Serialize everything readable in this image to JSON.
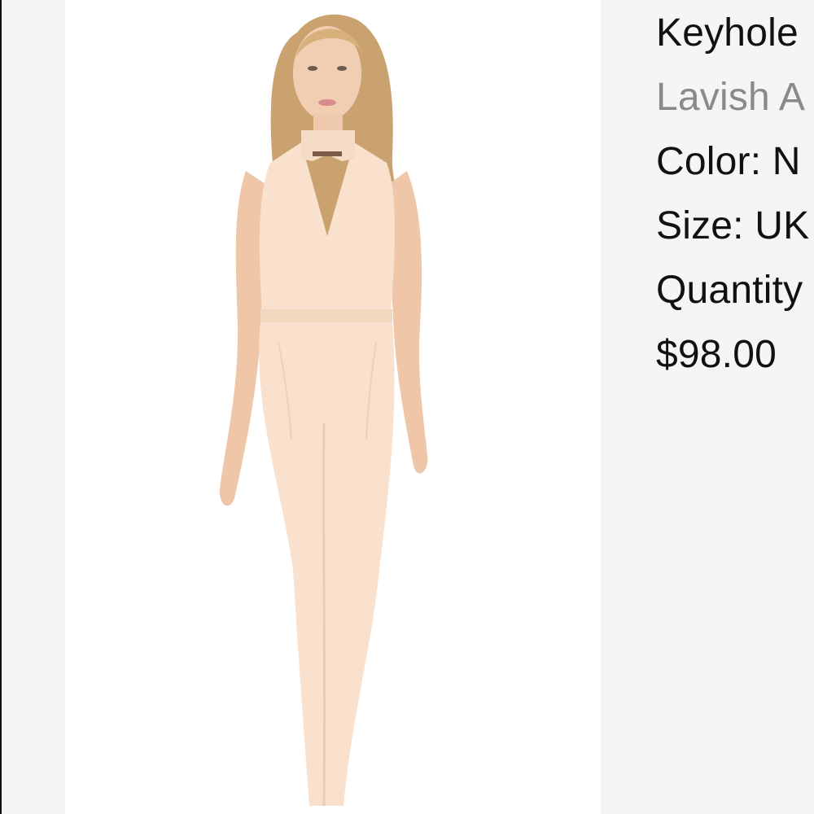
{
  "product": {
    "title": "Keyhole",
    "brand": "Lavish A",
    "color_label": "Color: N",
    "size_label": "Size: UK",
    "quantity_label": "Quantity",
    "price": "$98.00"
  },
  "image": {
    "subject": "model-wearing-jumpsuit"
  },
  "colors": {
    "background": "#f5f5f6",
    "text": "#111111",
    "brand_text": "#8a8a8a",
    "garment": "#f9e1cd"
  }
}
